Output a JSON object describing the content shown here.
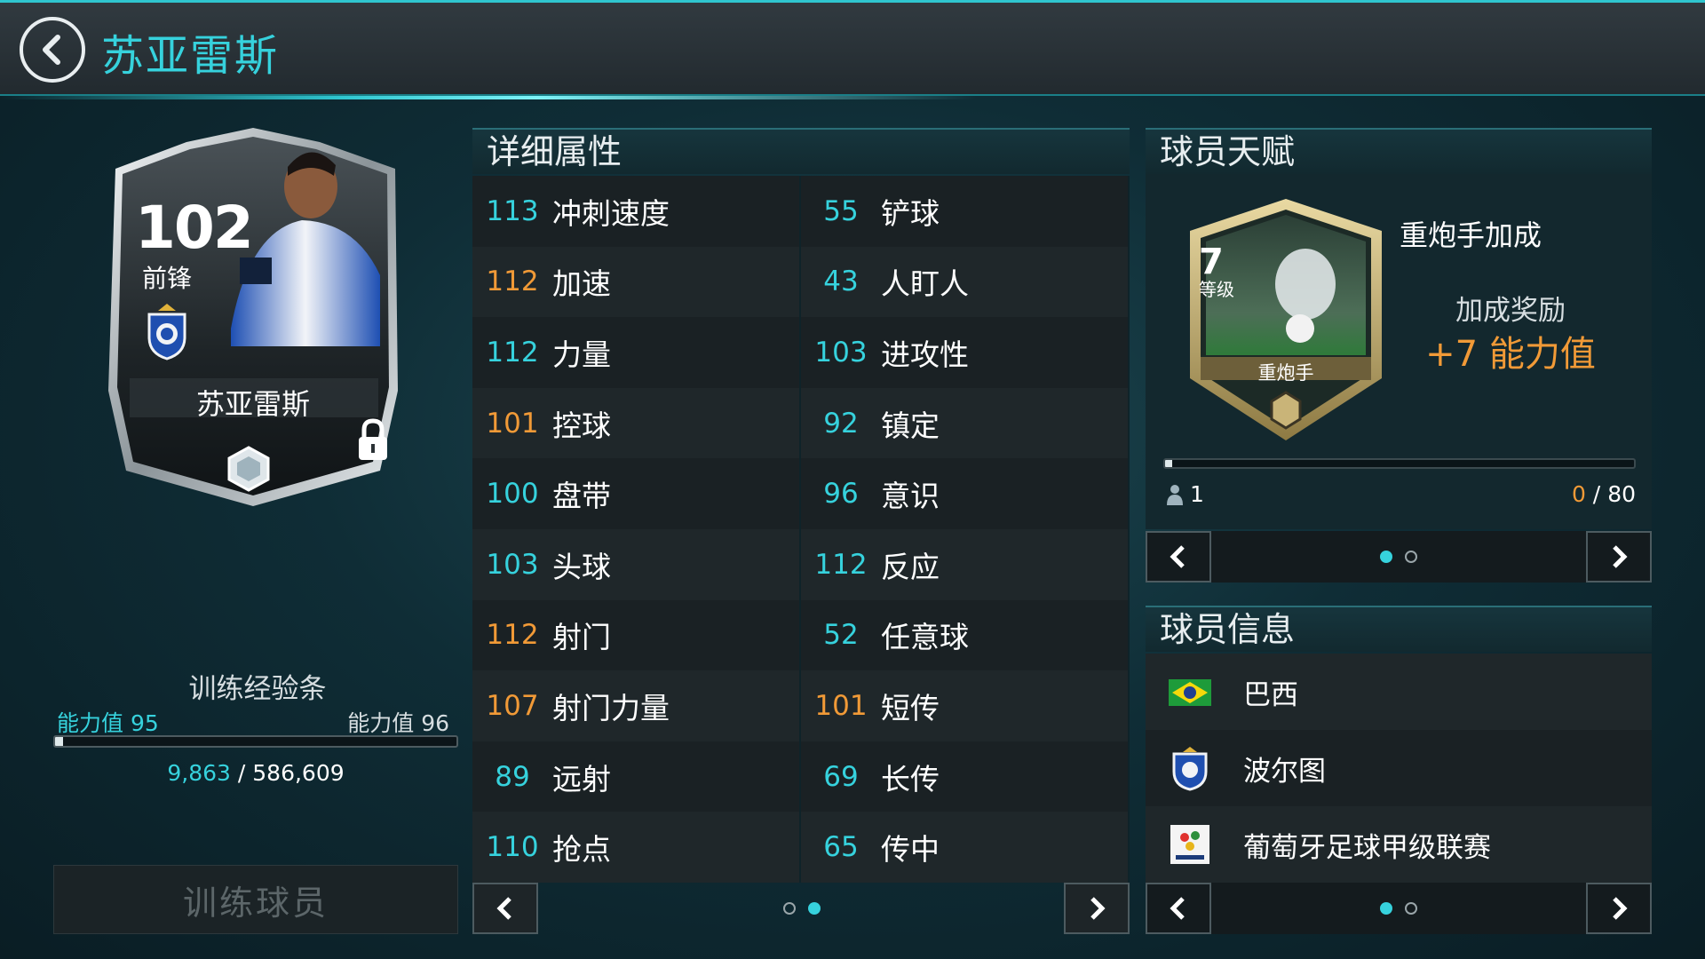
{
  "header": {
    "title": "苏亚雷斯"
  },
  "card": {
    "rating": "102",
    "position": "前锋",
    "name": "苏亚雷斯"
  },
  "training": {
    "title": "训练经验条",
    "left_label": "能力值",
    "left_value": "95",
    "right_label": "能力值",
    "right_value": "96",
    "current": "9,863",
    "separator": "/",
    "total": "586,609",
    "progress": 0.017,
    "button_label": "训练球员"
  },
  "attributes": {
    "title": "详细属性",
    "rows": [
      {
        "left": {
          "value": "113",
          "name": "冲刺速度",
          "color": "teal"
        },
        "right": {
          "value": "55",
          "name": "铲球",
          "color": "teal"
        }
      },
      {
        "left": {
          "value": "112",
          "name": "加速",
          "color": "orange"
        },
        "right": {
          "value": "43",
          "name": "人盯人",
          "color": "teal"
        }
      },
      {
        "left": {
          "value": "112",
          "name": "力量",
          "color": "teal"
        },
        "right": {
          "value": "103",
          "name": "进攻性",
          "color": "teal"
        }
      },
      {
        "left": {
          "value": "101",
          "name": "控球",
          "color": "orange"
        },
        "right": {
          "value": "92",
          "name": "镇定",
          "color": "teal"
        }
      },
      {
        "left": {
          "value": "100",
          "name": "盘带",
          "color": "teal"
        },
        "right": {
          "value": "96",
          "name": "意识",
          "color": "teal"
        }
      },
      {
        "left": {
          "value": "103",
          "name": "头球",
          "color": "teal"
        },
        "right": {
          "value": "112",
          "name": "反应",
          "color": "teal"
        }
      },
      {
        "left": {
          "value": "112",
          "name": "射门",
          "color": "orange"
        },
        "right": {
          "value": "52",
          "name": "任意球",
          "color": "teal"
        }
      },
      {
        "left": {
          "value": "107",
          "name": "射门力量",
          "color": "orange"
        },
        "right": {
          "value": "101",
          "name": "短传",
          "color": "orange"
        }
      },
      {
        "left": {
          "value": "89",
          "name": "远射",
          "color": "teal"
        },
        "right": {
          "value": "69",
          "name": "长传",
          "color": "teal"
        }
      },
      {
        "left": {
          "value": "110",
          "name": "抢点",
          "color": "teal"
        },
        "right": {
          "value": "65",
          "name": "传中",
          "color": "teal"
        }
      }
    ],
    "pager": {
      "pages": 2,
      "current": 2
    }
  },
  "talent": {
    "title": "球员天赋",
    "level": "7",
    "level_label": "等级",
    "badge_name": "重炮手",
    "name": "重炮手加成",
    "bonus_label": "加成奖励",
    "bonus_value": "+7 能力值",
    "people_count": "1",
    "progress_current": "0",
    "progress_separator": "/",
    "progress_total": "80",
    "progress": 0.0,
    "pager": {
      "pages": 2,
      "current": 1
    }
  },
  "info": {
    "title": "球员信息",
    "nation": "巴西",
    "club": "波尔图",
    "league": "葡萄牙足球甲级联赛",
    "pager": {
      "pages": 2,
      "current": 1
    }
  },
  "colors": {
    "accent": "#36d2dd",
    "highlight": "#f19a37",
    "background": "#0f2d36"
  }
}
